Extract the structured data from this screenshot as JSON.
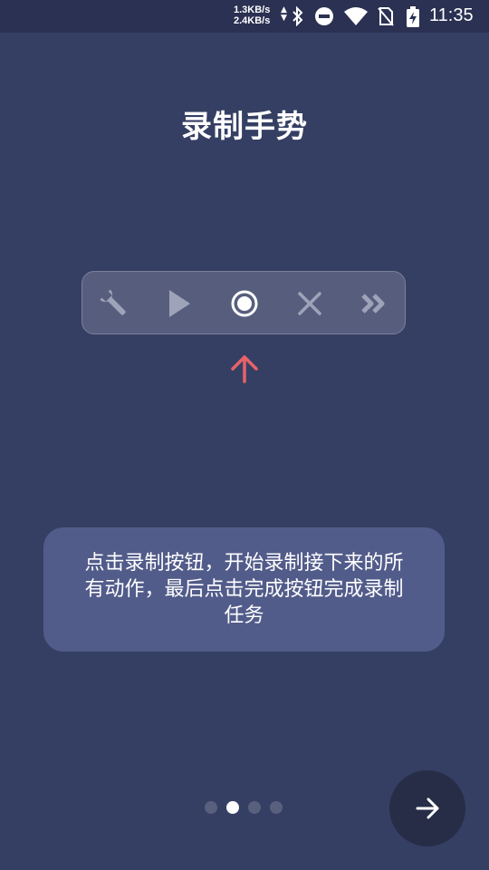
{
  "status_bar": {
    "net_up": "1.3KB/s",
    "net_down": "2.4KB/s",
    "time": "11:35",
    "icons": [
      "bluetooth-icon",
      "do-not-disturb-icon",
      "wifi-icon",
      "no-sim-icon",
      "battery-charging-icon"
    ]
  },
  "title": "录制手势",
  "toolbar": {
    "tools": [
      {
        "icon": "wrench-icon"
      },
      {
        "icon": "play-icon"
      },
      {
        "icon": "record-icon",
        "selected": true
      },
      {
        "icon": "close-icon"
      },
      {
        "icon": "fast-forward-icon"
      }
    ],
    "indicator_icon": "arrow-up-icon",
    "indicator_color": "#e8626a"
  },
  "card": {
    "line1": "点击录制按钮，开始录制接下来的所",
    "line2": "有动作，最后点击完成按钮完成录制",
    "line3": "任务"
  },
  "pager": {
    "count": 4,
    "active_index": 1
  },
  "next_button": {
    "icon": "arrow-right-icon"
  },
  "colors": {
    "background": "#353f63",
    "card": "#525c8a",
    "accent": "#e8626a"
  }
}
